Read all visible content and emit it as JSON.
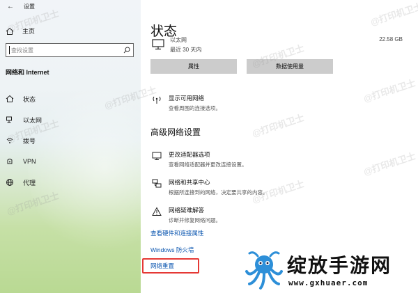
{
  "window": {
    "title": "设置"
  },
  "sidebar": {
    "home_label": "主页",
    "search_placeholder": "查找设置",
    "section_title": "网络和 Internet",
    "items": [
      {
        "label": "状态",
        "icon": "home-icon"
      },
      {
        "label": "以太网",
        "icon": "ethernet-icon"
      },
      {
        "label": "拨号",
        "icon": "dialup-icon"
      },
      {
        "label": "VPN",
        "icon": "vpn-icon"
      },
      {
        "label": "代理",
        "icon": "globe-icon"
      }
    ]
  },
  "main": {
    "title": "状态",
    "ethernet": {
      "name": "以太网",
      "period": "最近 30 天内",
      "usage": "22.58 GB"
    },
    "buttons": {
      "properties": "属性",
      "data_usage": "数据使用量"
    },
    "show_networks": {
      "title": "显示可用网络",
      "desc": "查看周围的连接选项。"
    },
    "advanced_title": "高级网络设置",
    "options": [
      {
        "title": "更改适配器选项",
        "desc": "查看网络适配器并更改连接设置。"
      },
      {
        "title": "网络和共享中心",
        "desc": "根据所连接到的网络，决定要共享的内容。"
      },
      {
        "title": "网络疑难解答",
        "desc": "诊断并修复网络问题。"
      }
    ],
    "links": {
      "hardware": "查看硬件和连接属性",
      "firewall": "Windows 防火墙",
      "reset": "网络重置"
    },
    "highlight_color": "#e53935",
    "link_color": "#0d57b0"
  },
  "watermark": {
    "text": "@打印机卫士"
  },
  "brand": {
    "name": "绽放手游网",
    "url": "www.gxhuaer.com"
  }
}
